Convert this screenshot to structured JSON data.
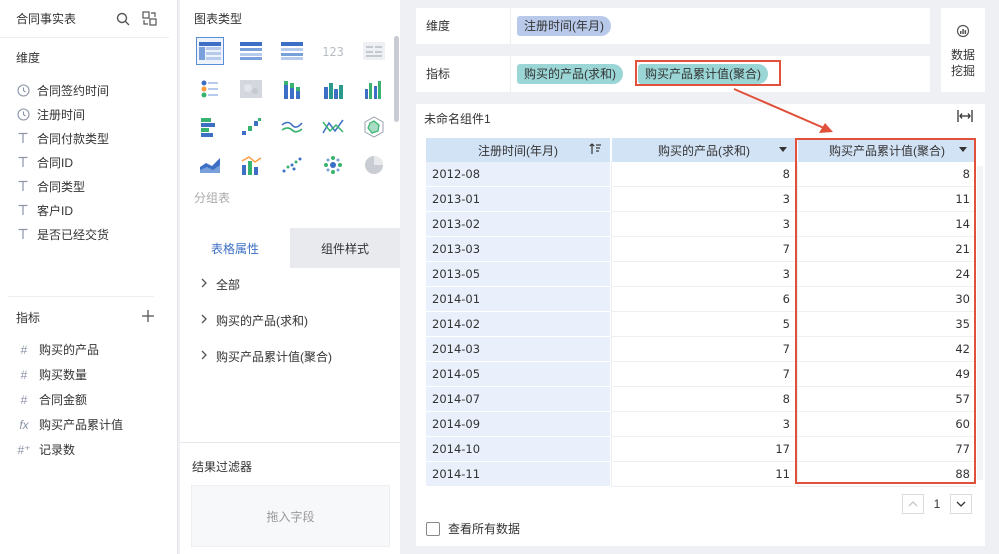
{
  "left_panel": {
    "title": "合同事实表",
    "dimension_title": "维度",
    "dimensions": [
      {
        "icon": "clock-icon",
        "label": "合同签约时间"
      },
      {
        "icon": "clock-icon",
        "label": "注册时间"
      },
      {
        "icon": "text-type-icon",
        "label": "合同付款类型"
      },
      {
        "icon": "text-type-icon",
        "label": "合同ID"
      },
      {
        "icon": "text-type-icon",
        "label": "合同类型"
      },
      {
        "icon": "text-type-icon",
        "label": "客户ID"
      },
      {
        "icon": "text-type-icon",
        "label": "是否已经交货"
      }
    ],
    "metric_title": "指标",
    "metrics": [
      {
        "icon": "hash-icon",
        "glyph": "#",
        "label": "购买的产品"
      },
      {
        "icon": "hash-icon",
        "glyph": "#",
        "label": "购买数量"
      },
      {
        "icon": "hash-icon",
        "glyph": "#",
        "label": "合同金额"
      },
      {
        "icon": "formula-icon",
        "glyph": "fx",
        "label": "购买产品累计值"
      },
      {
        "icon": "record-count-icon",
        "glyph": "#⁺",
        "label": "记录数"
      }
    ]
  },
  "middle_panel": {
    "chart_type_title": "图表类型",
    "group_label": "分组表",
    "tabs": [
      "表格属性",
      "组件样式"
    ],
    "properties": [
      "全部",
      "购买的产品(求和)",
      "购买产品累计值(聚合)"
    ],
    "filter_title": "结果过滤器",
    "drop_placeholder": "拖入字段"
  },
  "config": {
    "dimension_label": "维度",
    "dimension_pill": "注册时间(年月)",
    "metric_label": "指标",
    "metric_pills": [
      "购买的产品(求和)",
      "购买产品累计值(聚合)"
    ]
  },
  "mining": {
    "label": "数据挖掘"
  },
  "widget": {
    "title": "未命名组件1",
    "columns": [
      "注册时间(年月)",
      "购买的产品(求和)",
      "购买产品累计值(聚合)"
    ],
    "rows": [
      [
        "2012-08",
        "8",
        "8"
      ],
      [
        "2013-01",
        "3",
        "11"
      ],
      [
        "2013-02",
        "3",
        "14"
      ],
      [
        "2013-03",
        "7",
        "21"
      ],
      [
        "2013-05",
        "3",
        "24"
      ],
      [
        "2014-01",
        "6",
        "30"
      ],
      [
        "2014-02",
        "5",
        "35"
      ],
      [
        "2014-03",
        "7",
        "42"
      ],
      [
        "2014-05",
        "7",
        "49"
      ],
      [
        "2014-07",
        "8",
        "57"
      ],
      [
        "2014-09",
        "3",
        "60"
      ],
      [
        "2014-10",
        "17",
        "77"
      ],
      [
        "2014-11",
        "11",
        "88"
      ]
    ],
    "page": "1",
    "show_all_label": "查看所有数据"
  },
  "colors": {
    "accent_blue": "#3d6fc4",
    "highlight_red": "#e0503a",
    "dimension_pill": "#b8c9ea",
    "metric_pill": "#9bd6d6",
    "table_header": "#d3e3f6"
  }
}
